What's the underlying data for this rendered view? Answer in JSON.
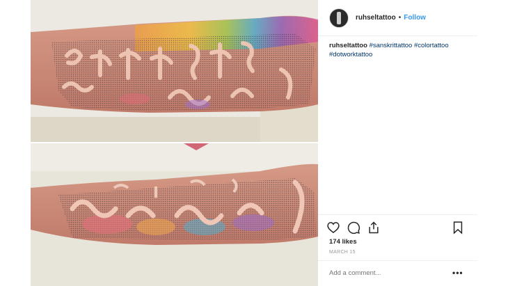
{
  "post": {
    "username": "ruhseltattoo",
    "follow_label": "Follow",
    "caption_user": "ruhseltattoo",
    "hashtags": [
      "#sanskrittattoo",
      "#colortattoo",
      "#dotworktattoo"
    ],
    "likes": "174 likes",
    "date": "MARCH 15",
    "comment_placeholder": "Add a comment...",
    "more_icon": "•••"
  },
  "icons": {
    "like": "heart-icon",
    "comment": "comment-icon",
    "share": "share-icon",
    "save": "bookmark-icon"
  },
  "colors": {
    "link_blue": "#3897f0",
    "hashtag": "#003569",
    "text": "#262626",
    "muted": "#999999"
  }
}
